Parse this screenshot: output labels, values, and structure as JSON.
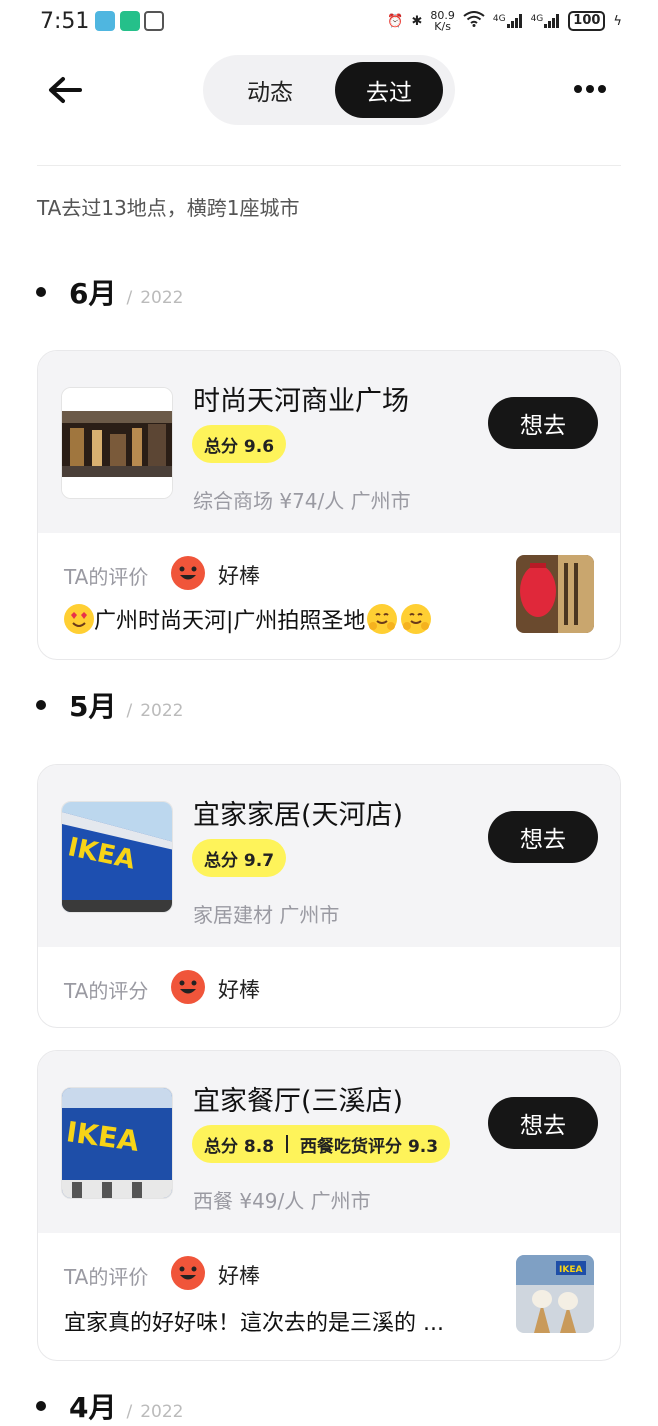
{
  "status_bar": {
    "time": "7:51",
    "net_speed_value": "80.9",
    "net_speed_unit": "K/s",
    "sig1": "4G",
    "sig2": "4G",
    "battery": "100"
  },
  "header": {
    "tabs": [
      {
        "label": "动态",
        "active": false
      },
      {
        "label": "去过",
        "active": true
      }
    ]
  },
  "summary": "TA去过13地点，横跨1座城市",
  "months": [
    {
      "month": "6月",
      "sep": "/",
      "year": "2022"
    },
    {
      "month": "5月",
      "sep": "/",
      "year": "2022"
    },
    {
      "month": "4月",
      "sep": "/",
      "year": "2022"
    }
  ],
  "places": [
    {
      "name": "时尚天河商业广场",
      "score": "总分 9.6",
      "score_extra": "",
      "meta": "综合商场  ¥74/人  广州市",
      "want_label": "想去",
      "review_label": "TA的评价",
      "review_rating": "好棒",
      "review_text": "广州时尚天河|广州拍照圣地"
    },
    {
      "name": "宜家家居(天河店)",
      "score": "总分 9.7",
      "score_extra": "",
      "meta": "家居建材  广州市",
      "want_label": "想去",
      "review_label": "TA的评分",
      "review_rating": "好棒",
      "review_text": ""
    },
    {
      "name": "宜家餐厅(三溪店)",
      "score": "总分 8.8",
      "score_extra": "西餐吃货评分 9.3",
      "meta": "西餐  ¥49/人  广州市",
      "want_label": "想去",
      "review_label": "TA的评价",
      "review_rating": "好棒",
      "review_text": "宜家真的好好味！這次去的是三溪的 ..."
    }
  ],
  "colors": {
    "accent_dark": "#161616",
    "score_yellow": "#fef35a",
    "smiley_red": "#f0553a",
    "card_bg": "#f4f4f6"
  }
}
